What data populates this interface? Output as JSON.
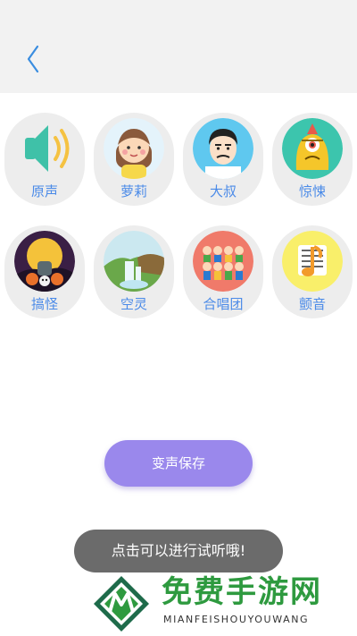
{
  "header": {
    "back_icon": "chevron-left-icon",
    "accent": "#3a8de0"
  },
  "voices": [
    {
      "label": "原声",
      "icon": "speaker-icon"
    },
    {
      "label": "萝莉",
      "icon": "girl-avatar-icon"
    },
    {
      "label": "大叔",
      "icon": "man-avatar-icon"
    },
    {
      "label": "惊悚",
      "icon": "monster-avatar-icon"
    },
    {
      "label": "搞怪",
      "icon": "halloween-avatar-icon"
    },
    {
      "label": "空灵",
      "icon": "waterfall-avatar-icon"
    },
    {
      "label": "合唱团",
      "icon": "choir-avatar-icon"
    },
    {
      "label": "颤音",
      "icon": "music-note-avatar-icon"
    }
  ],
  "actions": {
    "save_label": "变声保存",
    "save_color": "#9a88ec"
  },
  "toast": {
    "message": "点击可以进行试听哦!"
  },
  "watermark": {
    "title": "免费手游网",
    "subtitle": "MIANFEISHOUYOUWANG"
  },
  "colors": {
    "label": "#4a8ae8",
    "card": "#ededed",
    "header_bg": "#f2f2f2"
  }
}
